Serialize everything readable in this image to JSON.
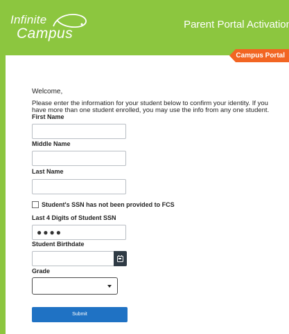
{
  "header": {
    "logo_line1": "Infinite",
    "logo_line2": "Campus",
    "title": "Parent Portal Activation",
    "ribbon": "Campus Portal"
  },
  "form": {
    "welcome": "Welcome,",
    "intro": "Please enter the information for your student below to confirm your identity. If you have more than one student enrolled, you may use the info from any one student.",
    "first_name_label": "First Name",
    "middle_name_label": "Middle Name",
    "last_name_label": "Last Name",
    "ssn_checkbox_prefix": "Student's SSN has ",
    "ssn_checkbox_emphasis": "not",
    "ssn_checkbox_suffix": " been provided to FCS",
    "ssn_checked": false,
    "ssn_label": "Last 4 Digits of Student SSN",
    "ssn_value": "●●●●",
    "birthdate_label": "Student Birthdate",
    "grade_label": "Grade",
    "submit_label": "Submit"
  },
  "icons": {
    "calendar": "calendar-icon",
    "dropdown": "chevron-down-icon",
    "logo_swoosh": "logo-swoosh-icon"
  },
  "colors": {
    "brand_green": "#8cc63f",
    "ribbon_orange": "#f26522",
    "submit_blue": "#1f72c4"
  }
}
